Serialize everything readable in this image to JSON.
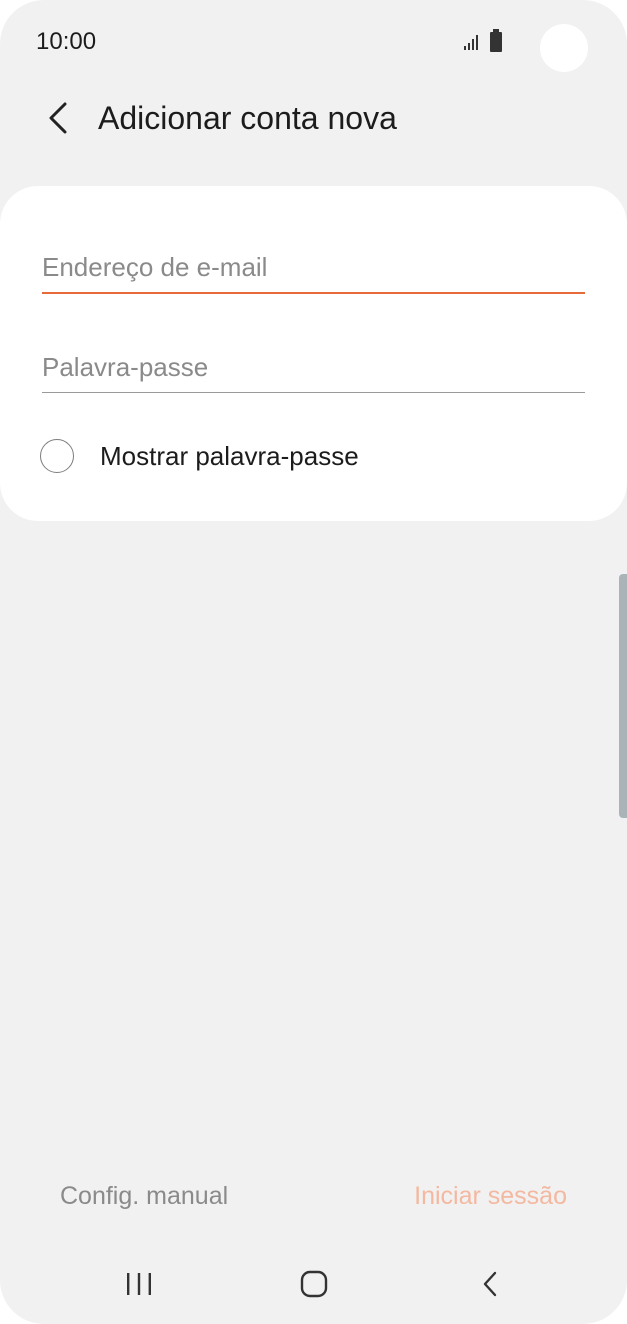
{
  "status_bar": {
    "time": "10:00",
    "icons": [
      "signal-icon",
      "battery-icon"
    ]
  },
  "header": {
    "title": "Adicionar conta nova",
    "back_icon": "chevron-left-icon"
  },
  "form": {
    "email_placeholder": "Endereço de e-mail",
    "email_value": "",
    "password_placeholder": "Palavra-passe",
    "password_value": "",
    "show_password_label": "Mostrar palavra-passe",
    "show_password_checked": false
  },
  "actions": {
    "manual_config_label": "Config. manual",
    "sign_in_label": "Iniciar sessão"
  },
  "nav_bar": {
    "icons": [
      "recents-icon",
      "home-icon",
      "back-icon"
    ]
  },
  "colors": {
    "accent": "#e8693a",
    "accent_disabled": "#f4b8a0",
    "background": "#f1f1f1",
    "card": "#ffffff"
  }
}
